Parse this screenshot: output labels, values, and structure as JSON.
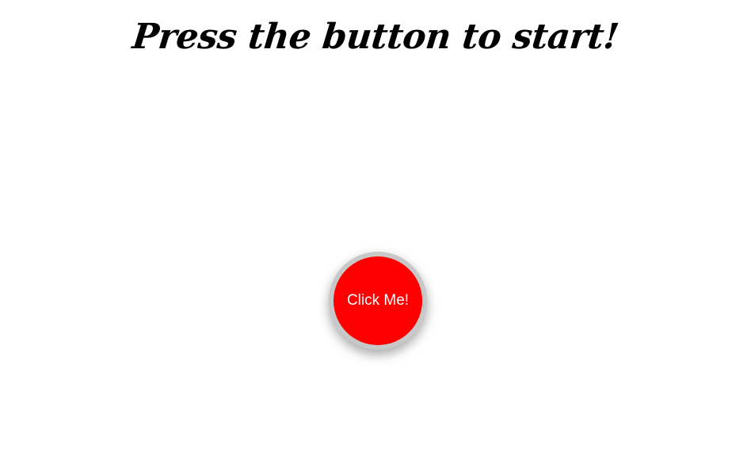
{
  "header": {
    "title": "Press the button to start!"
  },
  "main": {
    "start_button_label": "Click Me!"
  },
  "colors": {
    "button": "#ff0000",
    "button_ring": "#c8c8c8",
    "background": "#ffffff",
    "title": "#000000"
  }
}
